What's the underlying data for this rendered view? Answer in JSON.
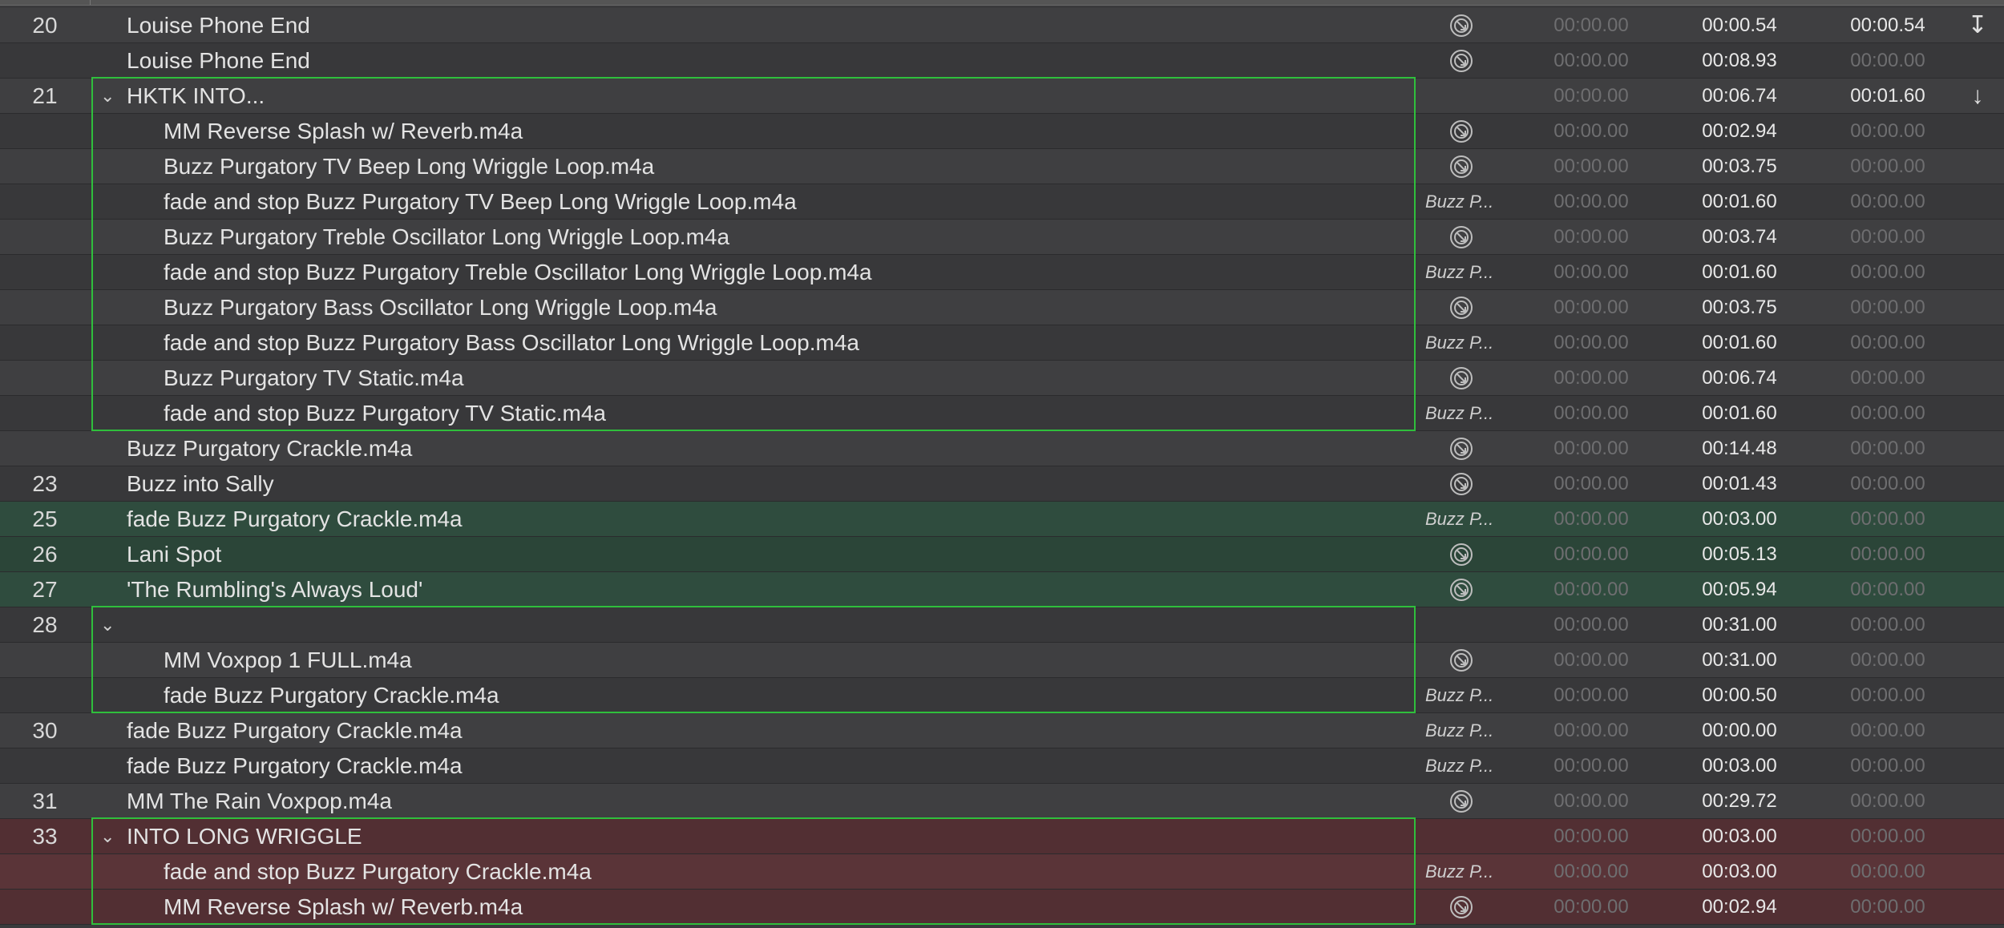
{
  "cues": [
    {
      "number": "20",
      "name": "Louise Phone End",
      "indent": 0,
      "target": "icon",
      "pre_wait": "00:00.00",
      "action": "00:00.54",
      "post_wait": "00:00.54",
      "post_bright": true,
      "continue": "↧",
      "color": "none"
    },
    {
      "number": "",
      "name": "Louise Phone End",
      "indent": 0,
      "target": "icon",
      "pre_wait": "00:00.00",
      "action": "00:08.93",
      "post_wait": "00:00.00",
      "post_bright": false,
      "continue": "",
      "color": "none"
    },
    {
      "number": "21",
      "name": "HKTK INTO...",
      "indent": 0,
      "group": true,
      "target": "",
      "pre_wait": "00:00.00",
      "action": "00:06.74",
      "post_wait": "00:01.60",
      "post_bright": true,
      "continue": "↓",
      "color": "none"
    },
    {
      "number": "",
      "name": "MM Reverse Splash w/ Reverb.m4a",
      "indent": 1,
      "target": "icon",
      "pre_wait": "00:00.00",
      "action": "00:02.94",
      "post_wait": "00:00.00",
      "post_bright": false,
      "continue": "",
      "color": "none"
    },
    {
      "number": "",
      "name": "Buzz Purgatory TV Beep Long Wriggle Loop.m4a",
      "indent": 1,
      "target": "icon",
      "pre_wait": "00:00.00",
      "action": "00:03.75",
      "post_wait": "00:00.00",
      "post_bright": false,
      "continue": "",
      "color": "none"
    },
    {
      "number": "",
      "name": "fade and stop Buzz Purgatory TV Beep Long Wriggle Loop.m4a",
      "indent": 1,
      "target": "Buzz P...",
      "pre_wait": "00:00.00",
      "action": "00:01.60",
      "post_wait": "00:00.00",
      "post_bright": false,
      "continue": "",
      "color": "none"
    },
    {
      "number": "",
      "name": "Buzz Purgatory Treble Oscillator Long Wriggle Loop.m4a",
      "indent": 1,
      "target": "icon",
      "pre_wait": "00:00.00",
      "action": "00:03.74",
      "post_wait": "00:00.00",
      "post_bright": false,
      "continue": "",
      "color": "none"
    },
    {
      "number": "",
      "name": "fade and stop Buzz Purgatory Treble Oscillator Long Wriggle Loop.m4a",
      "indent": 1,
      "target": "Buzz P...",
      "pre_wait": "00:00.00",
      "action": "00:01.60",
      "post_wait": "00:00.00",
      "post_bright": false,
      "continue": "",
      "color": "none"
    },
    {
      "number": "",
      "name": "Buzz Purgatory Bass Oscillator Long Wriggle Loop.m4a",
      "indent": 1,
      "target": "icon",
      "pre_wait": "00:00.00",
      "action": "00:03.75",
      "post_wait": "00:00.00",
      "post_bright": false,
      "continue": "",
      "color": "none"
    },
    {
      "number": "",
      "name": "fade and stop Buzz Purgatory Bass Oscillator Long Wriggle Loop.m4a",
      "indent": 1,
      "target": "Buzz P...",
      "pre_wait": "00:00.00",
      "action": "00:01.60",
      "post_wait": "00:00.00",
      "post_bright": false,
      "continue": "",
      "color": "none"
    },
    {
      "number": "",
      "name": "Buzz Purgatory TV Static.m4a",
      "indent": 1,
      "target": "icon",
      "pre_wait": "00:00.00",
      "action": "00:06.74",
      "post_wait": "00:00.00",
      "post_bright": false,
      "continue": "",
      "color": "none"
    },
    {
      "number": "",
      "name": "fade and stop Buzz Purgatory TV Static.m4a",
      "indent": 1,
      "target": "Buzz P...",
      "pre_wait": "00:00.00",
      "action": "00:01.60",
      "post_wait": "00:00.00",
      "post_bright": false,
      "continue": "",
      "color": "none"
    },
    {
      "number": "",
      "name": "Buzz Purgatory Crackle.m4a",
      "indent": 0,
      "target": "icon",
      "pre_wait": "00:00.00",
      "action": "00:14.48",
      "post_wait": "00:00.00",
      "post_bright": false,
      "continue": "",
      "color": "none"
    },
    {
      "number": "23",
      "name": "Buzz into Sally",
      "indent": 0,
      "target": "icon",
      "pre_wait": "00:00.00",
      "action": "00:01.43",
      "post_wait": "00:00.00",
      "post_bright": false,
      "continue": "",
      "color": "none"
    },
    {
      "number": "25",
      "name": "fade Buzz Purgatory Crackle.m4a",
      "indent": 0,
      "target": "Buzz P...",
      "pre_wait": "00:00.00",
      "action": "00:03.00",
      "post_wait": "00:00.00",
      "post_bright": false,
      "continue": "",
      "color": "green"
    },
    {
      "number": "26",
      "name": "Lani Spot",
      "indent": 0,
      "target": "icon",
      "pre_wait": "00:00.00",
      "action": "00:05.13",
      "post_wait": "00:00.00",
      "post_bright": false,
      "continue": "",
      "color": "green"
    },
    {
      "number": "27",
      "name": "'The Rumbling's Always Loud'",
      "indent": 0,
      "target": "icon",
      "pre_wait": "00:00.00",
      "action": "00:05.94",
      "post_wait": "00:00.00",
      "post_bright": false,
      "continue": "",
      "color": "green"
    },
    {
      "number": "28",
      "name": "",
      "indent": 0,
      "group": true,
      "target": "",
      "pre_wait": "00:00.00",
      "action": "00:31.00",
      "post_wait": "00:00.00",
      "post_bright": false,
      "continue": "",
      "color": "none"
    },
    {
      "number": "",
      "name": "MM Voxpop 1 FULL.m4a",
      "indent": 1,
      "target": "icon",
      "pre_wait": "00:00.00",
      "action": "00:31.00",
      "post_wait": "00:00.00",
      "post_bright": false,
      "continue": "",
      "color": "none"
    },
    {
      "number": "",
      "name": "fade Buzz Purgatory Crackle.m4a",
      "indent": 1,
      "target": "Buzz P...",
      "pre_wait": "00:00.00",
      "action": "00:00.50",
      "post_wait": "00:00.00",
      "post_bright": false,
      "continue": "",
      "color": "none"
    },
    {
      "number": "30",
      "name": "fade Buzz Purgatory Crackle.m4a",
      "indent": 0,
      "target": "Buzz P...",
      "pre_wait": "00:00.00",
      "action": "00:00.00",
      "post_wait": "00:00.00",
      "post_bright": false,
      "continue": "",
      "color": "none"
    },
    {
      "number": "",
      "name": "fade Buzz Purgatory Crackle.m4a",
      "indent": 0,
      "target": "Buzz P...",
      "pre_wait": "00:00.00",
      "action": "00:03.00",
      "post_wait": "00:00.00",
      "post_bright": false,
      "continue": "",
      "color": "none"
    },
    {
      "number": "31",
      "name": "MM The Rain Voxpop.m4a",
      "indent": 0,
      "target": "icon",
      "pre_wait": "00:00.00",
      "action": "00:29.72",
      "post_wait": "00:00.00",
      "post_bright": false,
      "continue": "",
      "color": "none"
    },
    {
      "number": "33",
      "name": "INTO LONG WRIGGLE",
      "indent": 0,
      "group": true,
      "target": "",
      "pre_wait": "00:00.00",
      "action": "00:03.00",
      "post_wait": "00:00.00",
      "post_bright": false,
      "continue": "",
      "color": "red"
    },
    {
      "number": "",
      "name": "fade and stop Buzz Purgatory Crackle.m4a",
      "indent": 1,
      "target": "Buzz P...",
      "pre_wait": "00:00.00",
      "action": "00:03.00",
      "post_wait": "00:00.00",
      "post_bright": false,
      "continue": "",
      "color": "red"
    },
    {
      "number": "",
      "name": "MM Reverse Splash w/ Reverb.m4a",
      "indent": 1,
      "target": "icon",
      "pre_wait": "00:00.00",
      "action": "00:02.94",
      "post_wait": "00:00.00",
      "post_bright": false,
      "continue": "",
      "color": "red"
    }
  ],
  "colors": {
    "group_outline": "#2fbf3c",
    "row_green": "#2f4c3e",
    "row_red": "#5a3438",
    "background": "#3a3a3c"
  },
  "icons": {
    "target_icon": "target-set-icon",
    "group_disclosure": "chevron-down-icon",
    "continue_icon": "auto-continue-icon"
  }
}
